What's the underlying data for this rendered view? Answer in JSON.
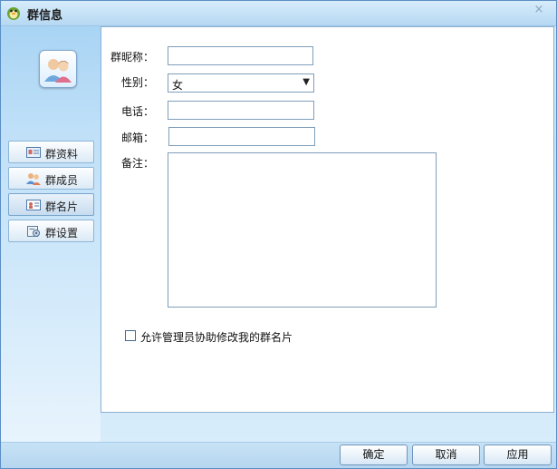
{
  "window": {
    "title": "群信息",
    "close_label": "×"
  },
  "sidebar": {
    "items": [
      {
        "label": "群资料",
        "icon": "profile-card-icon"
      },
      {
        "label": "群成员",
        "icon": "members-icon"
      },
      {
        "label": "群名片",
        "icon": "name-card-icon"
      },
      {
        "label": "群设置",
        "icon": "settings-icon"
      }
    ],
    "active_index": 2
  },
  "form": {
    "nickname": {
      "label": "群昵称：",
      "value": ""
    },
    "gender": {
      "label": "性别：",
      "value": "女"
    },
    "phone": {
      "label": "电话：",
      "value": ""
    },
    "email": {
      "label": "邮箱：",
      "value": ""
    },
    "note": {
      "label": "备注：",
      "value": ""
    },
    "allow_admin": {
      "label": "允许管理员协助修改我的群名片",
      "checked": false
    }
  },
  "footer": {
    "ok": "确定",
    "cancel": "取消",
    "apply": "应用"
  }
}
